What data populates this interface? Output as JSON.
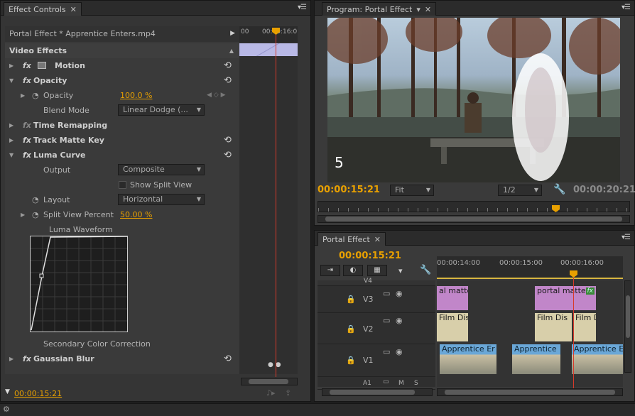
{
  "effect_controls": {
    "tab": "Effect Controls",
    "clip_header": "Portal Effect * Apprentice Enters.mp4",
    "ruler_times": [
      "00",
      "00:00:16:0"
    ],
    "video_effects_label": "Video Effects",
    "motion_label": "Motion",
    "opacity_label": "Opacity",
    "opacity_prop_label": "Opacity",
    "opacity_value": "100.0 %",
    "blend_mode_label": "Blend Mode",
    "blend_mode_value": "Linear Dodge (...",
    "time_remap_label": "Time Remapping",
    "track_matte_label": "Track Matte Key",
    "luma_curve_label": "Luma Curve",
    "output_label": "Output",
    "output_value": "Composite",
    "split_view_label": "Show Split View",
    "layout_label": "Layout",
    "layout_value": "Horizontal",
    "split_percent_label": "Split View Percent",
    "split_percent_value": "50.00 %",
    "waveform_label": "Luma Waveform",
    "secondary_cc_label": "Secondary Color Correction",
    "gaussian_blur_label": "Gaussian Blur",
    "timecode": "00:00:15:21"
  },
  "program": {
    "tab": "Program: Portal Effect",
    "overlay_number": "5",
    "timecode": "00:00:15:21",
    "fit_value": "Fit",
    "resolution_value": "1/2",
    "duration": "00:00:20:21"
  },
  "timeline": {
    "tab": "Portal Effect",
    "timecode": "00:00:15:21",
    "ruler_times": [
      "00:00:14:00",
      "00:00:15:00",
      "00:00:16:00"
    ],
    "tracks": [
      {
        "name": "V4"
      },
      {
        "name": "V3"
      },
      {
        "name": "V2"
      },
      {
        "name": "V1"
      },
      {
        "name": "A1"
      }
    ],
    "a1_toggles": [
      "M",
      "S"
    ],
    "clips": {
      "v3_a": "al matte",
      "v3_b": "portal matte",
      "v3_b_fx": "fx",
      "v2_a": "Film Dis",
      "v2_b": "Film Dis",
      "v2_c": "Film D",
      "v1_a": "Apprentice Er",
      "v1_b": "Apprentice",
      "v1_c": "Apprentice E"
    }
  },
  "colors": {
    "accent": "#e8a000",
    "playhead": "#d83a2a",
    "matte_clip": "#c186c9",
    "video_clip": "#6aa7d7"
  }
}
